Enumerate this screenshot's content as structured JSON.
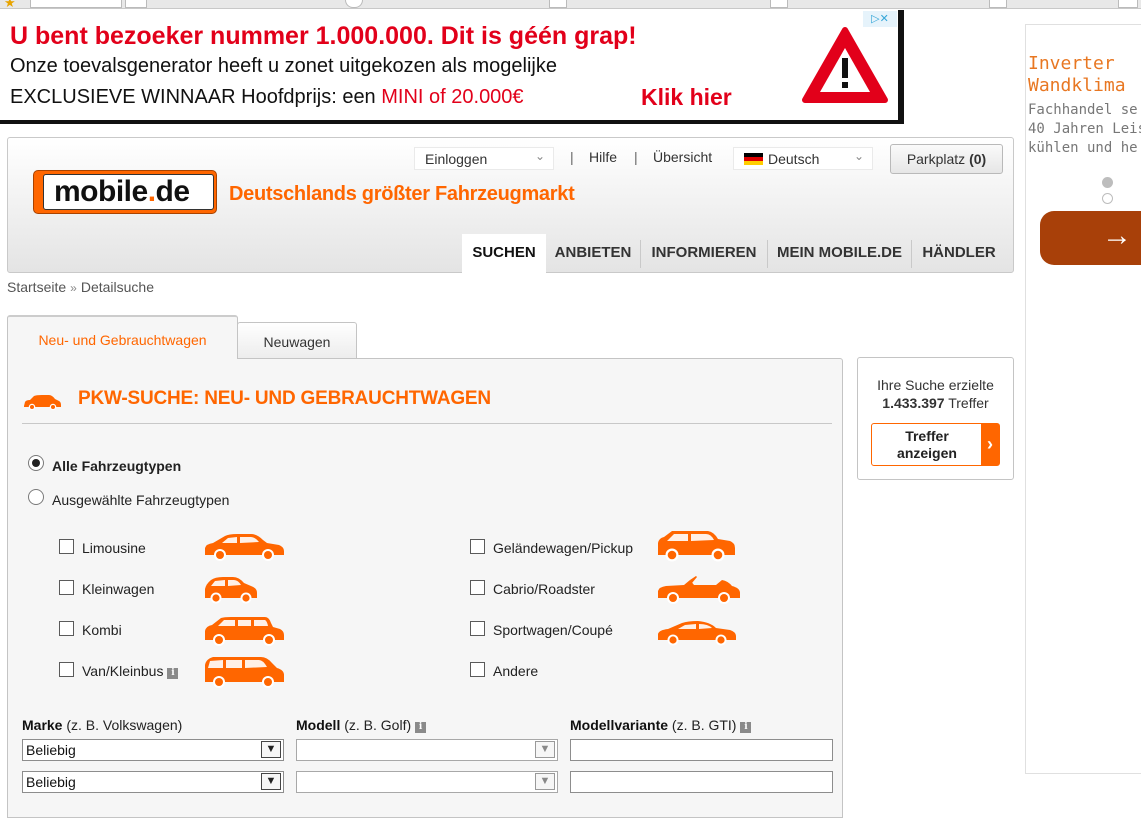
{
  "top_ad": {
    "line1": "U bent bezoeker nummer 1.000.000. Dit is géén grap!",
    "line2": "Onze toevalsgenerator heeft u zonet uitgekozen als mogelijke",
    "line3_prefix": "EXCLUSIEVE WINNAAR Hoofdprijs: een ",
    "line3_highlight": "MINI of 20.000€",
    "cta": "Klik hier",
    "adchoices_label": "▷✕"
  },
  "right_ad": {
    "title_line1": "Inverter",
    "title_line2": "Wandklima",
    "desc_line1": "Fachhandel se",
    "desc_line2": "40 Jahren Leis",
    "desc_line3": "kühlen und he",
    "button_glyph": "→",
    "dot_active_color": "#bdbdbd"
  },
  "header": {
    "login_select": "Einloggen",
    "help_link": "Hilfe",
    "overview_link": "Übersicht",
    "separator": "|",
    "language_select": "Deutsch",
    "parking_label": "Parkplatz",
    "parking_count": "(0)",
    "logo_prefix": "mobile",
    "logo_dot": ".",
    "logo_suffix": "de",
    "slogan": "Deutschlands größter Fahrzeugmarkt",
    "nav": [
      {
        "label": "SUCHEN",
        "active": true
      },
      {
        "label": "ANBIETEN",
        "active": false
      },
      {
        "label": "INFORMIEREN",
        "active": false
      },
      {
        "label": "MEIN MOBILE.DE",
        "active": false
      },
      {
        "label": "HÄNDLER",
        "active": false
      }
    ]
  },
  "breadcrumb": {
    "home": "Startseite",
    "separator": "»",
    "current": "Detailsuche"
  },
  "search_tabs": [
    {
      "label": "Neu- und Gebrauchtwagen",
      "active": true
    },
    {
      "label": "Neuwagen",
      "active": false
    }
  ],
  "panel": {
    "title": "PKW-SUCHE: NEU- UND GEBRAUCHTWAGEN",
    "radio_all": "Alle Fahrzeugtypen",
    "radio_selected": "Ausgewählte Fahrzeugtypen",
    "vehicle_types": [
      {
        "label": "Limousine",
        "icon": "sedan-car-icon",
        "checked": false
      },
      {
        "label": "Kleinwagen",
        "icon": "small-car-icon",
        "checked": false
      },
      {
        "label": "Kombi",
        "icon": "estate-car-icon",
        "checked": false
      },
      {
        "label": "Van/Kleinbus",
        "icon": "van-icon",
        "checked": false,
        "info": "i"
      },
      {
        "label": "Geländewagen/Pickup",
        "icon": "suv-icon",
        "checked": false
      },
      {
        "label": "Cabrio/Roadster",
        "icon": "cabrio-icon",
        "checked": false
      },
      {
        "label": "Sportwagen/Coupé",
        "icon": "coupe-icon",
        "checked": false
      },
      {
        "label": "Andere",
        "checked": false
      }
    ],
    "fields": {
      "make_label": "Marke",
      "make_hint": "(z. B. Volkswagen)",
      "model_label": "Modell",
      "model_hint": "(z. B. Golf)",
      "variant_label": "Modellvariante",
      "variant_hint": "(z. B. GTI)",
      "info_glyph": "i",
      "make_value_1": "Beliebig",
      "make_value_2": "Beliebig",
      "model_value_1": "",
      "model_value_2": "",
      "variant_value_1": "",
      "variant_value_2": ""
    }
  },
  "results": {
    "line1": "Ihre Suche erzielte",
    "count": "1.433.397",
    "unit": "Treffer",
    "button_line1": "Treffer",
    "button_line2": "anzeigen"
  },
  "colors": {
    "brand_orange": "#ff6600",
    "ad_red": "#e2001a",
    "right_ad_button": "#a84009"
  }
}
